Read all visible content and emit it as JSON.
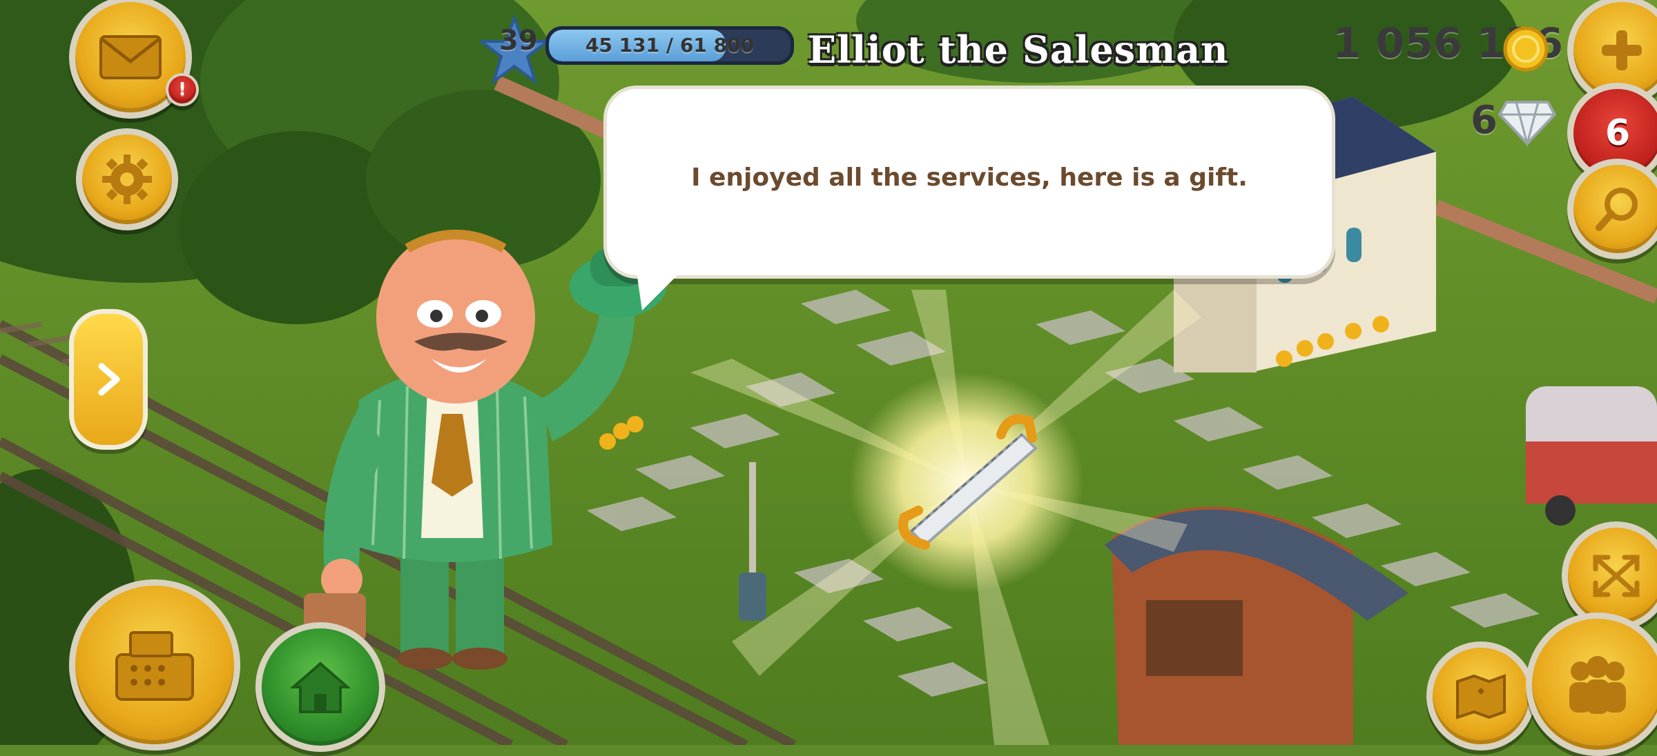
{
  "hud": {
    "level": "39",
    "xp_text": "45 131 / 61 800",
    "xp_fraction": 0.73,
    "coins": "1 056 136",
    "diamonds": "6",
    "badge_count": "6",
    "mail_alert": "!"
  },
  "dialog": {
    "speaker": "Elliot the Salesman",
    "message": "I enjoyed all the services, here is a gift."
  },
  "icons": {
    "mail": "envelope-icon",
    "settings": "gear-icon",
    "expand": "arrow-right-icon",
    "shop": "cash-register-icon",
    "home": "house-icon",
    "add": "plus-icon",
    "search": "magnifier-icon",
    "fullscreen": "expand-arrows-icon",
    "map": "map-icon",
    "friends": "friends-icon",
    "coin": "coin-icon",
    "diamond": "diamond-icon",
    "gift": "saw-icon"
  },
  "colors": {
    "button_gold": "#e8a81a",
    "button_green": "#2f8f2a",
    "button_red": "#bd1f1a",
    "xp_fill": "#5b9fd8",
    "dialog_text": "#6b4a2e"
  }
}
